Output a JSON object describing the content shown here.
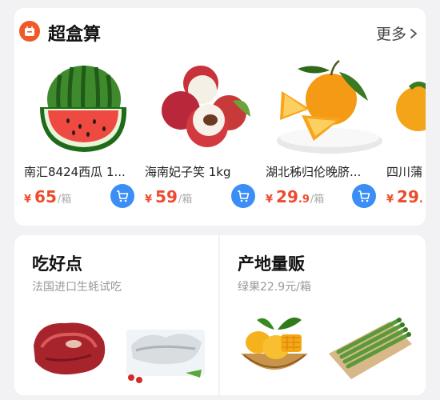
{
  "section": {
    "title": "超盒算",
    "more_label": "更多"
  },
  "products": [
    {
      "name": "南汇8424西瓜 1...",
      "currency": "¥",
      "price_int": "65",
      "price_dec": "",
      "unit": "/箱",
      "image": "watermelon"
    },
    {
      "name": "海南妃子笑 1kg",
      "currency": "¥",
      "price_int": "59",
      "price_dec": "",
      "unit": "/箱",
      "image": "lychee"
    },
    {
      "name": "湖北秭归伦晚脐...",
      "currency": "¥",
      "price_int": "29",
      "price_dec": ".9",
      "unit": "/箱",
      "image": "navel-orange"
    },
    {
      "name": "四川蒲",
      "currency": "¥",
      "price_int": "29",
      "price_dec": ".",
      "unit": "",
      "image": "citrus"
    }
  ],
  "promo_cards": [
    {
      "title": "吃好点",
      "subtitle": "法国进口生蚝试吃",
      "images": [
        "raw-meat",
        "frozen-meat-tray"
      ]
    },
    {
      "title": "产地量贩",
      "subtitle": "绿果22.9元/箱",
      "images": [
        "mango-basket",
        "asparagus-board"
      ]
    }
  ],
  "colors": {
    "accent_orange": "#f05a28",
    "price_red": "#ef4a2e",
    "cart_blue": "#3a8ef6"
  },
  "icons": [
    "basket-logo-icon",
    "chevron-right-icon",
    "cart-icon"
  ]
}
